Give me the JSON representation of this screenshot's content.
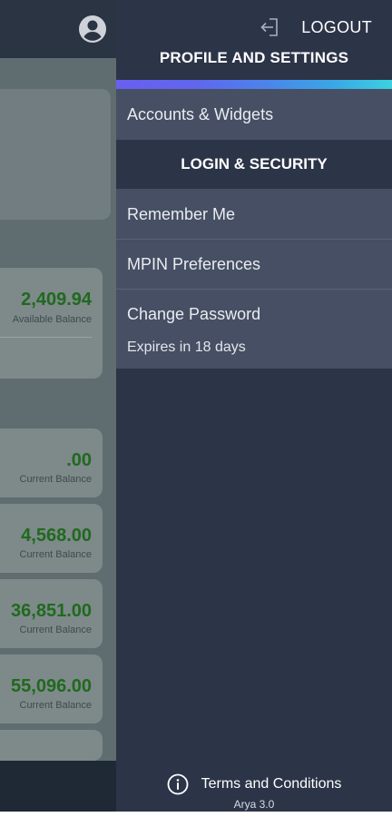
{
  "background": {
    "cards": [
      {
        "amount": "2,409.94",
        "caption": "Available Balance"
      },
      {
        "amount": ".00",
        "caption": "Current Balance"
      },
      {
        "amount": "4,568.00",
        "caption": "Current Balance"
      },
      {
        "amount": "36,851.00",
        "caption": "Current Balance"
      },
      {
        "amount": "55,096.00",
        "caption": "Current Balance"
      },
      {
        "amount": "",
        "caption": ""
      }
    ],
    "icons": {
      "profile": "account-circle-icon"
    }
  },
  "drawer": {
    "logout_label": "LOGOUT",
    "title": "PROFILE AND SETTINGS",
    "items": {
      "accounts_widgets": "Accounts & Widgets",
      "section_login_security": "LOGIN & SECURITY",
      "remember_me": "Remember Me",
      "mpin_preferences": "MPIN Preferences",
      "change_password": "Change Password",
      "password_expiry": "Expires in 18 days"
    },
    "footer": {
      "terms_label": "Terms and Conditions",
      "version": "Arya 3.0"
    },
    "icons": {
      "logout": "logout-icon",
      "info": "info-icon"
    },
    "colors": {
      "drawer_bg": "#2c3448",
      "item_bg": "#464f63",
      "gradient_start": "#6a5ff0",
      "gradient_end": "#3bd1e0",
      "balance_green": "#1f6a1d"
    }
  }
}
